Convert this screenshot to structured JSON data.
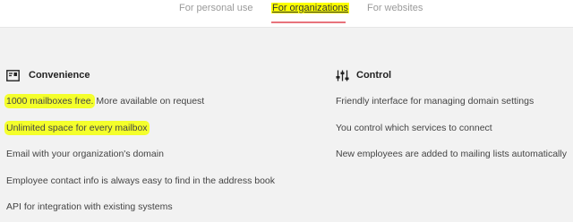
{
  "tabs": [
    {
      "label": "For personal use",
      "active": false
    },
    {
      "label": "For organizations",
      "active": true
    },
    {
      "label": "For websites",
      "active": false
    }
  ],
  "colors": {
    "accent_underline": "#e8737c",
    "highlight": "#f4ff2b",
    "background": "#f2f2f2"
  },
  "convenience": {
    "icon": "mail-badge-icon",
    "title": "Convenience",
    "items": [
      {
        "highlighted": "1000 mailboxes free.",
        "rest": " More available on request"
      },
      {
        "highlighted": "Unlimited space for every mailbox",
        "rest": ""
      },
      {
        "highlighted": "",
        "rest": "Email with your organization's domain"
      },
      {
        "highlighted": "",
        "rest": "Employee contact info is always easy to find in the address book"
      },
      {
        "highlighted": "",
        "rest": "API for integration with existing systems"
      }
    ]
  },
  "control": {
    "icon": "sliders-icon",
    "title": "Control",
    "items": [
      "Friendly interface for managing domain settings",
      "You control which services to connect",
      "New employees are added to mailing lists automatically"
    ]
  }
}
